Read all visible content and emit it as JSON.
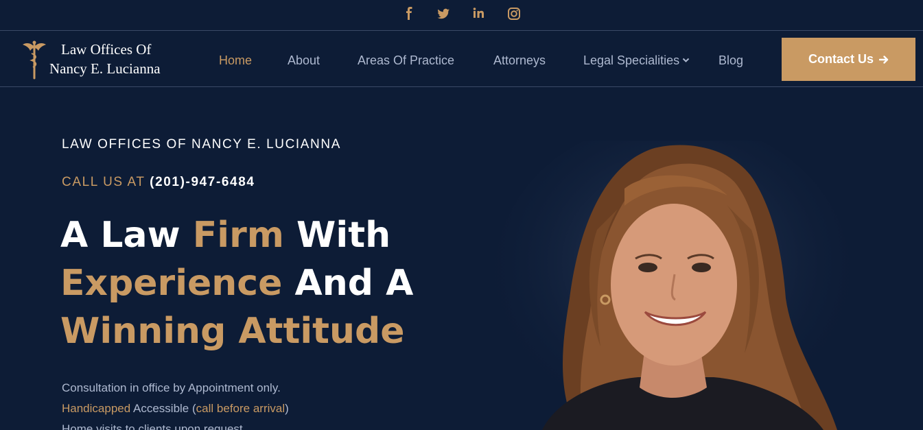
{
  "social": [
    "facebook-icon",
    "twitter-icon",
    "linkedin-icon",
    "instagram-icon"
  ],
  "logo": {
    "line1": "Law Offices Of",
    "line2": "Nancy E. Lucianna"
  },
  "nav": {
    "home": "Home",
    "about": "About",
    "areas": "Areas Of Practice",
    "attorneys": "Attorneys",
    "legal": "Legal Specialities",
    "blog": "Blog"
  },
  "contact_button": {
    "label": "Contact Us",
    "icon": "arrow-right-icon"
  },
  "hero": {
    "eyebrow": "LAW OFFICES OF NANCY E. LUCIANNA",
    "call_label": "CALL US AT",
    "phone": "(201)-947-6484",
    "headline": {
      "w1": "A Law",
      "w2": "Firm",
      "w3": "With",
      "w4": "Experience",
      "w5": "And A",
      "w6": "Winning Attitude"
    },
    "info": {
      "line1": "Consultation in office by Appointment only.",
      "handicapped": "Handicapped",
      "accessible": "Accessible",
      "paren_open": "(",
      "call_before": "call before arrival",
      "paren_close": ")",
      "line3": "Home visits to clients upon request"
    }
  },
  "colors": {
    "background": "#0d1c36",
    "accent": "#c99a63",
    "nav_text": "#aeb9d0"
  }
}
